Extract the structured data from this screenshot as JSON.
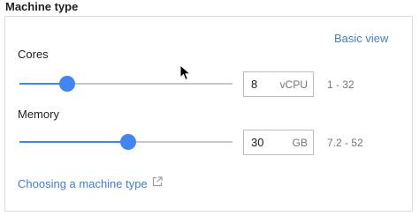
{
  "section": {
    "title": "Machine type"
  },
  "panel": {
    "basic_view_label": "Basic view",
    "cores": {
      "label": "Cores",
      "value": "8",
      "unit": "vCPU",
      "range": "1 - 32",
      "min": 1,
      "max": 32,
      "current": 8
    },
    "memory": {
      "label": "Memory",
      "value": "30",
      "unit": "GB",
      "range": "7.2 - 52",
      "min": 7.2,
      "max": 52,
      "current": 30
    },
    "help_link": {
      "label": "Choosing a machine type",
      "icon": "external-link-icon"
    }
  },
  "colors": {
    "accent": "#4285f4",
    "link": "#3f7fd0",
    "track": "#c8c8c8",
    "border": "#dadce0"
  }
}
